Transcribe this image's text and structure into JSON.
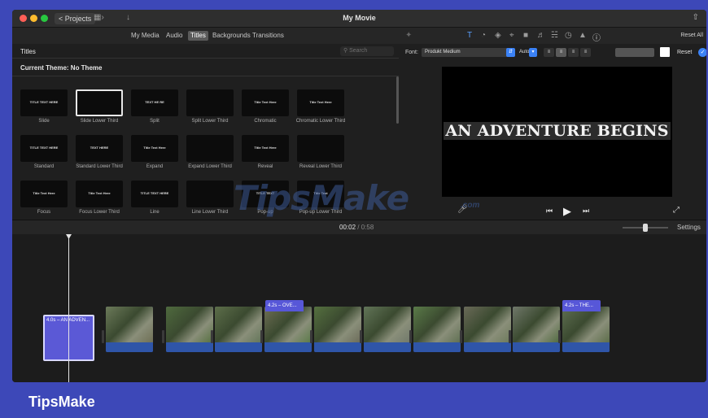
{
  "window": {
    "title": "My Movie",
    "projects_label": "Projects",
    "projects_chevron": "<",
    "layout_icon": "layout-icon",
    "download_icon": "download-icon",
    "share_icon": "share-icon"
  },
  "browser": {
    "tabs": [
      "My Media",
      "Audio",
      "Titles",
      "Backgrounds",
      "Transitions"
    ],
    "active_tab": "Titles",
    "section_label": "Titles",
    "search_placeholder": "Search",
    "theme_label": "Current Theme: No Theme",
    "tiles": [
      {
        "label": "Slide",
        "mini": "TITLE TEXT HERE"
      },
      {
        "label": "Slide Lower Third",
        "mini": "",
        "selected": true
      },
      {
        "label": "Split",
        "mini": "TEXT HE RE"
      },
      {
        "label": "Split Lower Third",
        "mini": ""
      },
      {
        "label": "Chromatic",
        "mini": "Title Text Here"
      },
      {
        "label": "Chromatic Lower Third",
        "mini": "Title Text Here"
      },
      {
        "label": "Standard",
        "mini": "TITLE TEXT HERE"
      },
      {
        "label": "Standard Lower Third",
        "mini": "TEXT HERE"
      },
      {
        "label": "Expand",
        "mini": "Title Text Here"
      },
      {
        "label": "Expand Lower Third",
        "mini": ""
      },
      {
        "label": "Reveal",
        "mini": "Title Text Here"
      },
      {
        "label": "Reveal Lower Third",
        "mini": ""
      },
      {
        "label": "Focus",
        "mini": "Title Text Here"
      },
      {
        "label": "Focus Lower Third",
        "mini": "Title Text Here"
      },
      {
        "label": "Line",
        "mini": "TITLE TEXT HERE"
      },
      {
        "label": "Line Lower Third",
        "mini": ""
      },
      {
        "label": "Pop-up",
        "mini": "TITLE TEXT"
      },
      {
        "label": "Pop-up Lower Third",
        "mini": "Title Text"
      }
    ]
  },
  "viewer": {
    "reset_all": "Reset All",
    "font_label": "Font:",
    "font_value": "Produkt Medium",
    "size_value": "Auto",
    "reset_label": "Reset",
    "preview_title": "AN ADVENTURE BEGINS",
    "text_color": "#ffffff"
  },
  "timeline": {
    "timecode_current": "00:02",
    "timecode_sep": " / ",
    "timecode_total": "0:58",
    "settings_label": "Settings",
    "first_title": "4.0s – AN ADVEN...",
    "title_clips": [
      "4.2s – OVE...",
      "4.2s – THE..."
    ],
    "clip_count": 10
  },
  "watermark": {
    "main": "TipsMake",
    "suffix": ".com"
  },
  "brand": "TipsMake",
  "colors": {
    "accent": "#3b82f6",
    "title_clip": "#5b59d6",
    "frame": "#3d48b8"
  }
}
